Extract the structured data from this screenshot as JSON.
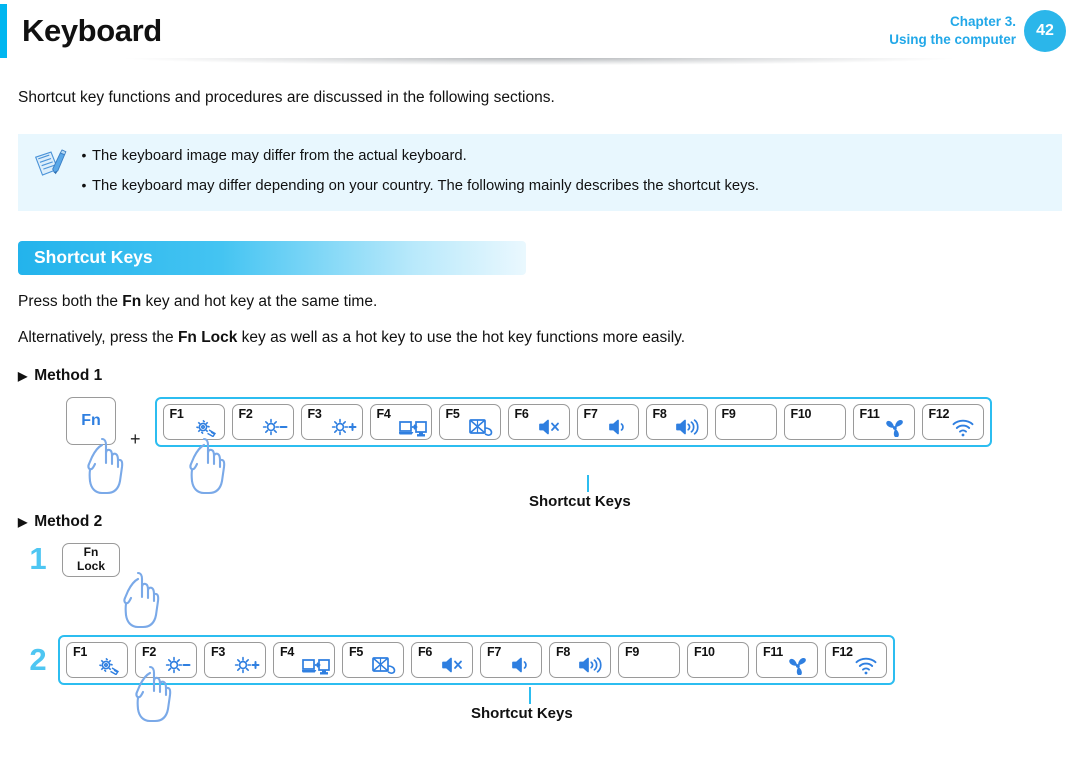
{
  "header": {
    "title": "Keyboard",
    "chapter_line1": "Chapter 3.",
    "chapter_line2": "Using the computer",
    "page_number": "42",
    "accent_color": "#00b6f0",
    "chapter_text_color": "#22a8e8",
    "page_circle_color": "#2bb6ea"
  },
  "intro": {
    "text": "Shortcut key functions and procedures are discussed in the following sections."
  },
  "note": {
    "icon": "note-pencil-icon",
    "background_color": "#e8f7fe",
    "bullet": "•",
    "items": [
      "The keyboard image may differ from the actual keyboard.",
      "The keyboard may differ depending on your country. The following mainly describes the shortcut keys."
    ]
  },
  "section": {
    "title": "Shortcut Keys",
    "gradient_start": "#23b3ec",
    "gradient_end": "#eaf8fe"
  },
  "paragraphs": {
    "p1_before": "Press both the ",
    "p1_bold": "Fn",
    "p1_after": " key and hot key at the same time.",
    "p2_before": "Alternatively, press the ",
    "p2_bold": "Fn Lock",
    "p2_after": " key as well as a hot key to use the hot key functions more easily."
  },
  "method1": {
    "arrow": "▶",
    "heading": "Method 1",
    "fn_key_label": "Fn",
    "fn_key_color": "#2f7fe0",
    "plus": "+",
    "caption": "Shortcut Keys",
    "strip_border_color": "#2cbdf0"
  },
  "method2": {
    "arrow": "▶",
    "heading": "Method 2",
    "step1_number": "1",
    "step2_number": "2",
    "fnlock_line1": "Fn",
    "fnlock_line2": "Lock",
    "caption": "Shortcut Keys",
    "step_number_color": "#4ec6f2"
  },
  "function_keys": [
    {
      "label": "F1",
      "icon": "settings-gear-icon"
    },
    {
      "label": "F2",
      "icon": "brightness-down-icon"
    },
    {
      "label": "F3",
      "icon": "brightness-up-icon"
    },
    {
      "label": "F4",
      "icon": "external-display-icon"
    },
    {
      "label": "F5",
      "icon": "touchpad-off-icon"
    },
    {
      "label": "F6",
      "icon": "volume-mute-icon"
    },
    {
      "label": "F7",
      "icon": "volume-down-icon"
    },
    {
      "label": "F8",
      "icon": "volume-up-icon"
    },
    {
      "label": "F9",
      "icon": "none"
    },
    {
      "label": "F10",
      "icon": "none"
    },
    {
      "label": "F11",
      "icon": "fan-icon"
    },
    {
      "label": "F12",
      "icon": "wifi-icon"
    }
  ],
  "colors": {
    "icon_blue": "#2f7fe0",
    "strip_blue": "#2cbdf0",
    "hand_blue": "#7aa9e8"
  }
}
